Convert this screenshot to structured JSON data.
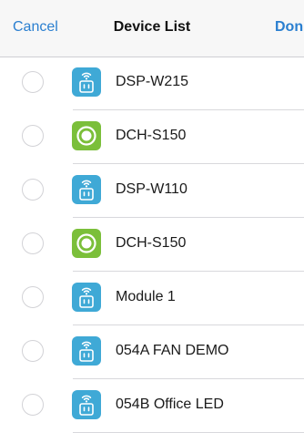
{
  "nav": {
    "cancel_label": "Cancel",
    "title": "Device List",
    "done_label": "Don"
  },
  "colors": {
    "accent": "#2a7fd0",
    "plug_icon_blue": "#3fa9d6",
    "sensor_icon_green": "#7bbf3a"
  },
  "devices": [
    {
      "name": "DSP-W215",
      "icon": "smart-plug-icon",
      "selected": false
    },
    {
      "name": "DCH-S150",
      "icon": "motion-sensor-icon",
      "selected": false
    },
    {
      "name": "DSP-W110",
      "icon": "smart-plug-icon",
      "selected": false
    },
    {
      "name": "DCH-S150",
      "icon": "motion-sensor-icon",
      "selected": false
    },
    {
      "name": "Module 1",
      "icon": "smart-plug-icon",
      "selected": false
    },
    {
      "name": "054A FAN DEMO",
      "icon": "smart-plug-icon",
      "selected": false
    },
    {
      "name": "054B Office LED",
      "icon": "smart-plug-icon",
      "selected": false
    }
  ]
}
